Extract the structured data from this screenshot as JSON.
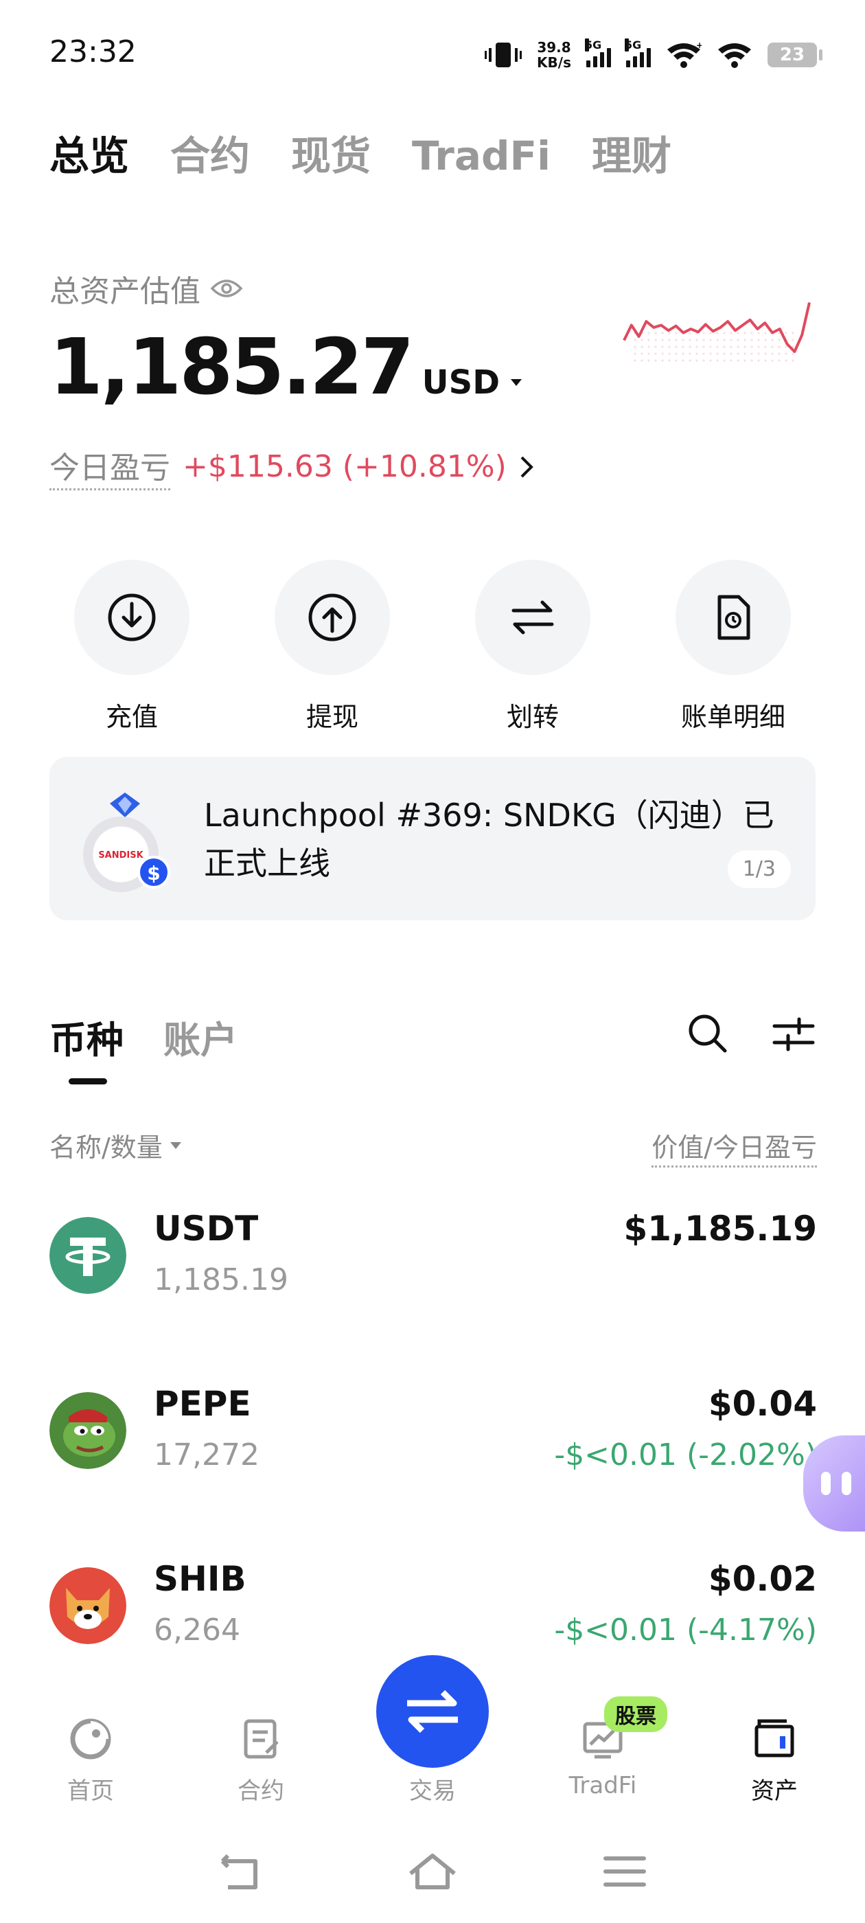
{
  "status_bar": {
    "time": "23:32",
    "net_speed_value": "39.8",
    "net_speed_unit": "KB/s",
    "sim1": "5G",
    "sim2": "5G",
    "battery": "23"
  },
  "top_tabs": [
    {
      "label": "总览",
      "active": true
    },
    {
      "label": "合约",
      "active": false
    },
    {
      "label": "现货",
      "active": false
    },
    {
      "label": "TradFi",
      "active": false
    },
    {
      "label": "理财",
      "active": false
    }
  ],
  "assets": {
    "label": "总资产估值",
    "total": "1,185.27",
    "currency": "USD",
    "pnl_label": "今日盈亏",
    "pnl_value": "+$115.63 (+10.81%)",
    "sparkline_color": "#e04a5e",
    "sparkline": [
      0.55,
      0.35,
      0.5,
      0.3,
      0.38,
      0.35,
      0.42,
      0.36,
      0.45,
      0.4,
      0.44,
      0.34,
      0.43,
      0.38,
      0.3,
      0.42,
      0.35,
      0.28,
      0.4,
      0.32,
      0.45,
      0.4,
      0.6,
      0.7,
      0.48,
      0.05
    ]
  },
  "actions": [
    {
      "label": "充值",
      "icon": "deposit-icon"
    },
    {
      "label": "提现",
      "icon": "withdraw-icon"
    },
    {
      "label": "划转",
      "icon": "transfer-icon"
    },
    {
      "label": "账单明细",
      "icon": "bill-icon"
    }
  ],
  "banner": {
    "text": "Launchpool #369: SNDKG（闪迪）已正式上线",
    "page": "1/3",
    "ring_brand": "SANDISK"
  },
  "coin_tabs": [
    {
      "label": "币种",
      "active": true
    },
    {
      "label": "账户",
      "active": false
    }
  ],
  "list_header": {
    "left": "名称/数量",
    "right": "价值/今日盈亏"
  },
  "holdings": [
    {
      "name": "USDT",
      "qty": "1,185.19",
      "value": "$1,185.19",
      "change": "",
      "logo_color": "#3f9e79"
    },
    {
      "name": "PEPE",
      "qty": "17,272",
      "value": "$0.04",
      "change": "-$<0.01 (-2.02%)",
      "logo_color": "#4d8a3a"
    },
    {
      "name": "SHIB",
      "qty": "6,264",
      "value": "$0.02",
      "change": "-$<0.01 (-4.17%)",
      "logo_color": "#e34b3c"
    }
  ],
  "bottom_nav": {
    "items": [
      {
        "label": "首页",
        "icon": "home-icon",
        "active": false
      },
      {
        "label": "合约",
        "icon": "contract-icon",
        "active": false
      },
      {
        "label": "TradFi",
        "icon": "tradfi-icon",
        "active": false
      },
      {
        "label": "资产",
        "icon": "wallet-icon",
        "active": true
      }
    ],
    "trade_label": "交易",
    "stock_badge": "股票",
    "accent": "#2354f0"
  }
}
